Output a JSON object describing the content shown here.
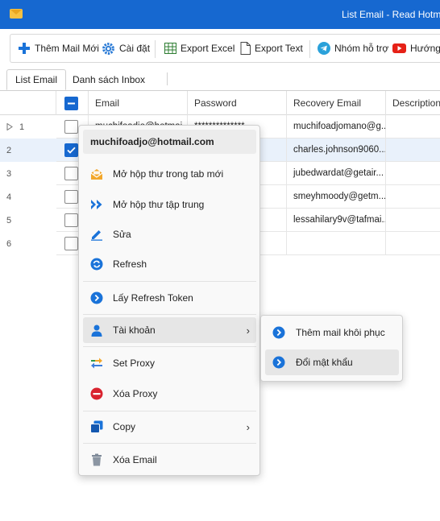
{
  "window": {
    "title": "List Email - Read Hotmail l",
    "icon": "envelope-icon",
    "accent": "#1668d0"
  },
  "toolbar": {
    "add_mail": "Thêm Mail Mới",
    "settings": "Cài đặt",
    "export_excel": "Export Excel",
    "export_text": "Export Text",
    "support_group": "Nhóm hỗ trợ",
    "guide": "Hướng d"
  },
  "tabs": [
    {
      "label": "List Email",
      "active": true
    },
    {
      "label": "Danh sách Inbox",
      "active": false
    }
  ],
  "grid": {
    "columns": [
      "Email",
      "Password",
      "Recovery Email",
      "Description"
    ],
    "rows": [
      {
        "num": "1",
        "checked": false,
        "email": "muchifoadjo@hotmai",
        "password": "**************",
        "recovery": "muchifoadjomano@g..."
      },
      {
        "num": "2",
        "checked": true,
        "email": "",
        "password": "",
        "recovery": "charles.johnson9060..."
      },
      {
        "num": "3",
        "checked": false,
        "email": "",
        "password": "",
        "recovery": "jubedwardat@getair..."
      },
      {
        "num": "4",
        "checked": false,
        "email": "",
        "password": "",
        "recovery": "smeyhmoody@getm..."
      },
      {
        "num": "5",
        "checked": false,
        "email": "",
        "password": "",
        "recovery": "lessahilary9v@tafmai..."
      },
      {
        "num": "6",
        "checked": false,
        "email": "",
        "password": "",
        "recovery": ""
      }
    ]
  },
  "context_menu": {
    "header": "muchifoadjo@hotmail.com",
    "items": [
      {
        "label": "Mở hộp thư trong tab mới",
        "icon": "open-envelope-icon"
      },
      {
        "label": "Mở hộp thư tập trung",
        "icon": "double-chevron-icon"
      },
      {
        "label": "Sửa",
        "icon": "pencil-icon"
      },
      {
        "label": "Refresh",
        "icon": "refresh-icon"
      },
      {
        "label": "Lấy Refresh Token",
        "icon": "chevron-circle-icon"
      },
      {
        "label": "Tài khoản",
        "icon": "user-icon"
      },
      {
        "label": "Set Proxy",
        "icon": "swap-arrows-icon"
      },
      {
        "label": "Xóa Proxy",
        "icon": "minus-circle-icon"
      },
      {
        "label": "Copy",
        "icon": "copy-icon"
      },
      {
        "label": "Xóa Email",
        "icon": "trash-icon"
      }
    ]
  },
  "submenu": {
    "items": [
      {
        "label": "Thêm mail khôi phục",
        "icon": "chevron-circle-icon"
      },
      {
        "label": "Đổi mật khẩu",
        "icon": "chevron-circle-icon"
      }
    ]
  }
}
